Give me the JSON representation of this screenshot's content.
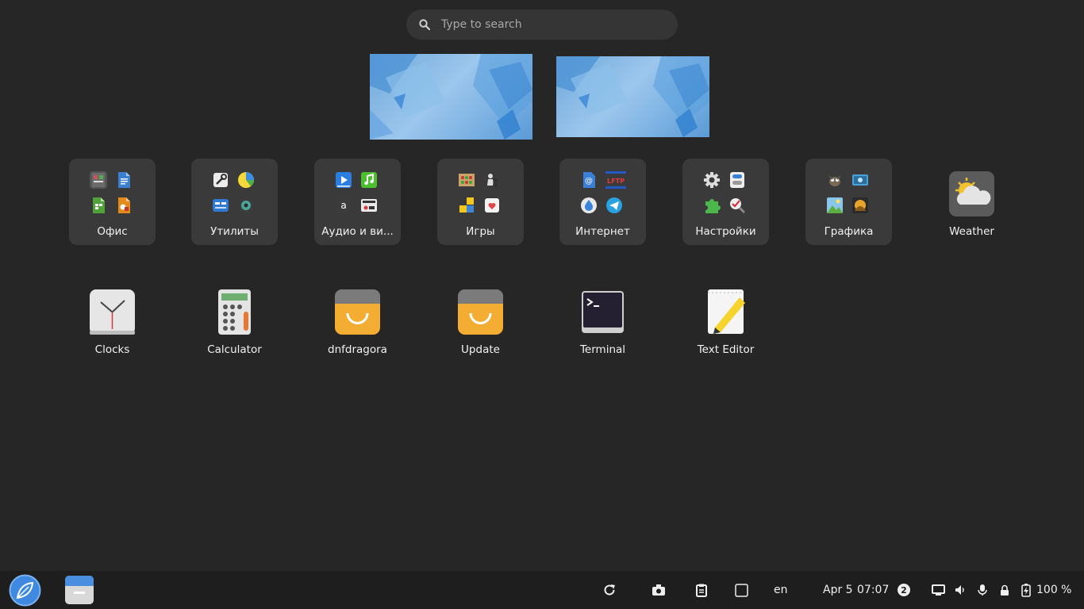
{
  "search": {
    "placeholder": "Type to search"
  },
  "folders": [
    {
      "label": "Офис"
    },
    {
      "label": "Утилиты"
    },
    {
      "label": "Аудио и ви..."
    },
    {
      "label": "Игры"
    },
    {
      "label": "Интернет"
    },
    {
      "label": "Настройки"
    },
    {
      "label": "Графика"
    }
  ],
  "apps_row1": [
    {
      "label": "Weather",
      "icon": "weather-icon"
    }
  ],
  "apps_row2": [
    {
      "label": "Clocks",
      "icon": "clock-icon"
    },
    {
      "label": "Calculator",
      "icon": "calculator-icon"
    },
    {
      "label": "dnfdragora",
      "icon": "package-bag-icon"
    },
    {
      "label": "Update",
      "icon": "package-bag-icon"
    },
    {
      "label": "Terminal",
      "icon": "terminal-icon"
    },
    {
      "label": "Text Editor",
      "icon": "text-editor-icon"
    }
  ],
  "taskbar": {
    "language": "en",
    "date": "Apr 5",
    "time": "07:07",
    "notification_count": "2",
    "battery": "100 %"
  },
  "colors": {
    "background": "#262626",
    "folder_bg": "#3a3a3a",
    "taskbar_bg": "#1e1e1e",
    "accent": "#3f8ae0"
  }
}
